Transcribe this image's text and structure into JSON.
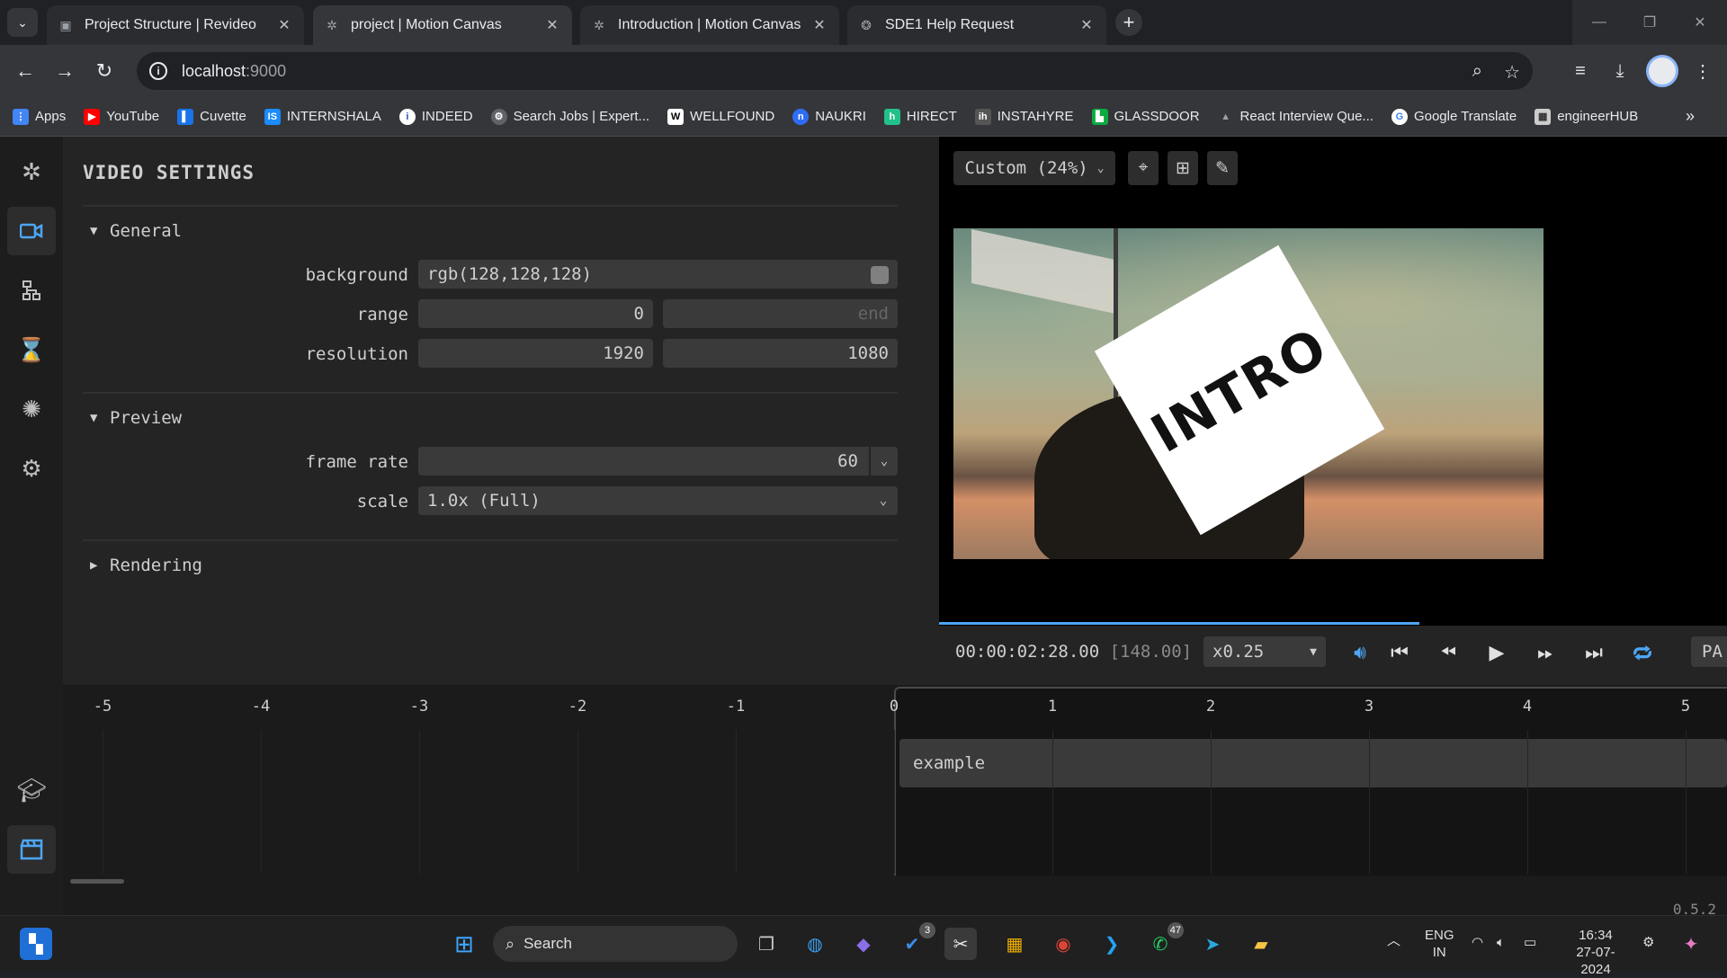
{
  "browser": {
    "tabs": [
      {
        "title": "Project Structure | Revideo",
        "active": false
      },
      {
        "title": "project | Motion Canvas",
        "active": true
      },
      {
        "title": "Introduction | Motion Canvas",
        "active": false
      },
      {
        "title": "SDE1 Help Request",
        "active": false
      }
    ],
    "url_host": "localhost",
    "url_port": ":9000",
    "bookmarks": [
      {
        "label": "Apps",
        "color": "#4285f4"
      },
      {
        "label": "YouTube",
        "color": "#ff0000"
      },
      {
        "label": "Cuvette",
        "color": "#1a73e8"
      },
      {
        "label": "INTERNSHALA",
        "color": "#1a8cff"
      },
      {
        "label": "INDEED",
        "color": "#ffffff"
      },
      {
        "label": "Search Jobs | Expert...",
        "color": "#bdbdbd"
      },
      {
        "label": "WELLFOUND",
        "color": "#ffffff"
      },
      {
        "label": "NAUKRI",
        "color": "#2f6df6"
      },
      {
        "label": "HIRECT",
        "color": "#22c08a"
      },
      {
        "label": "INSTAHYRE",
        "color": "#555555"
      },
      {
        "label": "GLASSDOOR",
        "color": "#0caa41"
      },
      {
        "label": "React Interview Que...",
        "color": "#9aa0a6"
      },
      {
        "label": "Google Translate",
        "color": "#4285f4"
      },
      {
        "label": "engineerHUB",
        "color": "#cccccc"
      }
    ]
  },
  "settings": {
    "title": "VIDEO SETTINGS",
    "general": {
      "header": "General",
      "background_label": "background",
      "background_value": "rgb(128,128,128)",
      "background_color": "#808080",
      "range_label": "range",
      "range_start": "0",
      "range_end_placeholder": "end",
      "resolution_label": "resolution",
      "resolution_width": "1920",
      "resolution_height": "1080"
    },
    "preview": {
      "header": "Preview",
      "frame_rate_label": "frame rate",
      "frame_rate_value": "60",
      "scale_label": "scale",
      "scale_value": "1.0x (Full)"
    },
    "rendering": {
      "header": "Rendering"
    }
  },
  "viewport": {
    "zoom_label": "Custom (24%)",
    "preview_text": "INTRO",
    "progress_fraction": 0.61
  },
  "player": {
    "time": "00:00:02:28.00",
    "frame": "[148.00]",
    "speed": "x0.25",
    "pa_label": "PA"
  },
  "timeline": {
    "ticks": [
      "-5",
      "-4",
      "-3",
      "-2",
      "-1",
      "0",
      "1",
      "2",
      "3",
      "4",
      "5"
    ],
    "clip_label": "example",
    "version": "0.5.2"
  },
  "taskbar": {
    "search_placeholder": "Search",
    "badge_vscode_ext": "3",
    "badge_whatsapp": "47",
    "lang_top": "ENG",
    "lang_bottom": "IN",
    "time": "16:34",
    "date": "27-07-2024"
  }
}
